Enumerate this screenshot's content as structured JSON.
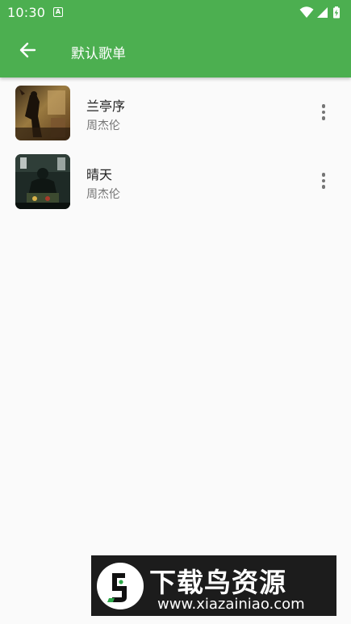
{
  "status_bar": {
    "time": "10:30",
    "notification_icon": "A",
    "icons": [
      "wifi-icon",
      "cell-signal-icon",
      "battery-charging-icon"
    ]
  },
  "app_bar": {
    "title": "默认歌单",
    "back_icon": "arrow-left-icon"
  },
  "songs": [
    {
      "title": "兰亭序",
      "artist": "周杰伦",
      "more_icon": "more-vert-icon"
    },
    {
      "title": "晴天",
      "artist": "周杰伦",
      "more_icon": "more-vert-icon"
    }
  ],
  "watermark": {
    "title": "下载鸟资源",
    "url": "www.xiazainiao.com"
  },
  "colors": {
    "primary": "#4caf50",
    "background": "#fafafa",
    "title_text": "#212121",
    "secondary_text": "#757575"
  }
}
